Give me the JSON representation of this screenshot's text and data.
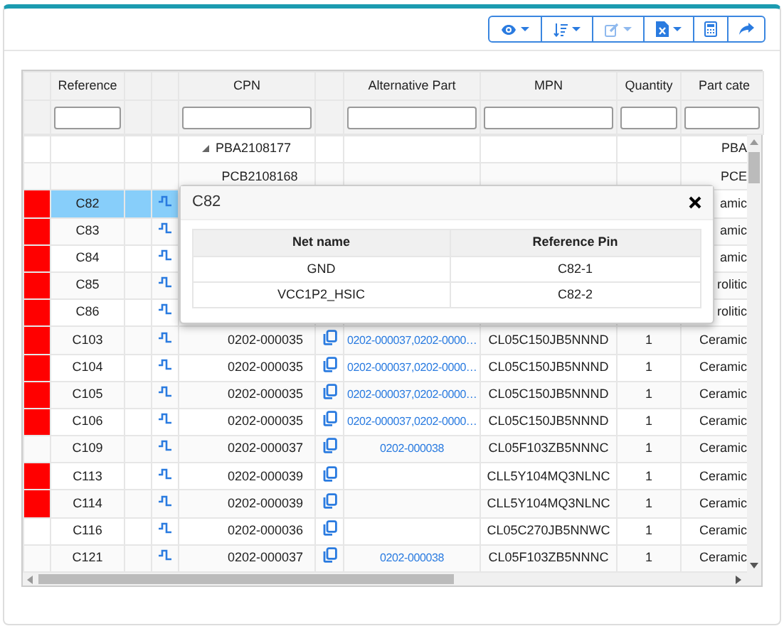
{
  "toolbar": [
    {
      "caret": true,
      "disabled": false
    },
    {
      "caret": true,
      "disabled": false
    },
    {
      "caret": true,
      "disabled": true
    },
    {
      "caret": true,
      "disabled": false
    },
    {
      "caret": false,
      "disabled": false
    },
    {
      "caret": false,
      "disabled": false
    }
  ],
  "table": {
    "headers": [
      "Reference",
      "CPN",
      "Alternative Part",
      "MPN",
      "Quantity",
      "Part cate"
    ],
    "rows": [
      {
        "kind": "group",
        "expanded": true,
        "cpn": "PBA2108177",
        "part_category": "PBA"
      },
      {
        "kind": "board",
        "cpn": "PCB2108168",
        "part_category": "PCE"
      },
      {
        "kind": "part",
        "flagged": true,
        "selected": true,
        "reference": "C82",
        "part_category": "amic"
      },
      {
        "kind": "part",
        "flagged": true,
        "selected": false,
        "reference": "C83",
        "part_category": "amic"
      },
      {
        "kind": "part",
        "flagged": true,
        "selected": false,
        "reference": "C84",
        "part_category": "amic"
      },
      {
        "kind": "part",
        "flagged": true,
        "selected": false,
        "reference": "C85",
        "part_category": "rolitic"
      },
      {
        "kind": "part",
        "flagged": true,
        "selected": false,
        "reference": "C86",
        "part_category": "rolitic"
      },
      {
        "kind": "part",
        "flagged": true,
        "selected": false,
        "reference": "C103",
        "cpn": "0202-000035",
        "alternative": "0202-000037,0202-0000…",
        "mpn": "CL05C150JB5NNND",
        "quantity": "1",
        "part_category": "Ceramic"
      },
      {
        "kind": "part",
        "flagged": true,
        "selected": false,
        "reference": "C104",
        "cpn": "0202-000035",
        "alternative": "0202-000037,0202-0000…",
        "mpn": "CL05C150JB5NNND",
        "quantity": "1",
        "part_category": "Ceramic"
      },
      {
        "kind": "part",
        "flagged": true,
        "selected": false,
        "reference": "C105",
        "cpn": "0202-000035",
        "alternative": "0202-000037,0202-0000…",
        "mpn": "CL05C150JB5NNND",
        "quantity": "1",
        "part_category": "Ceramic"
      },
      {
        "kind": "part",
        "flagged": true,
        "selected": false,
        "reference": "C106",
        "cpn": "0202-000035",
        "alternative": "0202-000037,0202-0000…",
        "mpn": "CL05C150JB5NNND",
        "quantity": "1",
        "part_category": "Ceramic"
      },
      {
        "kind": "part",
        "flagged": false,
        "selected": false,
        "reference": "C109",
        "cpn": "0202-000037",
        "alternative": "0202-000038",
        "mpn": "CL05F103ZB5NNNC",
        "quantity": "1",
        "part_category": "Ceramic"
      },
      {
        "kind": "part",
        "flagged": true,
        "selected": false,
        "reference": "C113",
        "cpn": "0202-000039",
        "mpn": "CLL5Y104MQ3NLNC",
        "quantity": "1",
        "part_category": "Ceramic"
      },
      {
        "kind": "part",
        "flagged": true,
        "selected": false,
        "reference": "C114",
        "cpn": "0202-000039",
        "mpn": "CLL5Y104MQ3NLNC",
        "quantity": "1",
        "part_category": "Ceramic"
      },
      {
        "kind": "part",
        "flagged": false,
        "selected": false,
        "reference": "C116",
        "cpn": "0202-000036",
        "mpn": "CL05C270JB5NNWC",
        "quantity": "1",
        "part_category": "Ceramic"
      },
      {
        "kind": "part",
        "flagged": false,
        "selected": false,
        "reference": "C121",
        "cpn": "0202-000037",
        "alternative": "0202-000038",
        "mpn": "CL05F103ZB5NNNC",
        "quantity": "1",
        "part_category": "Ceramic"
      }
    ]
  },
  "popup": {
    "title": "C82",
    "columns": [
      "Net name",
      "Reference Pin"
    ],
    "rows": [
      [
        "GND",
        "C82-1"
      ],
      [
        "VCC1P2_HSIC",
        "C82-2"
      ]
    ]
  }
}
